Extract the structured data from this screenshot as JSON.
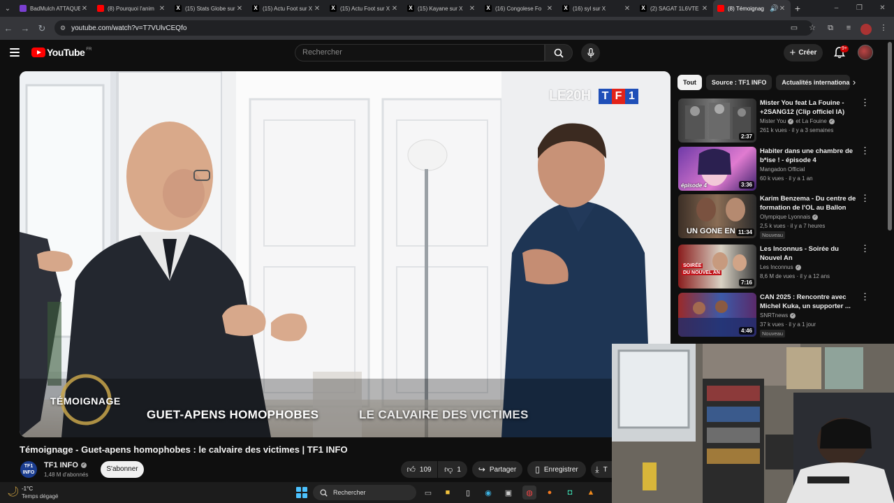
{
  "browser": {
    "tabs": [
      {
        "label": "BadMulch ATTAQUE",
        "favicon_color": "#7a3fd1"
      },
      {
        "label": "(8) Pourquoi l'anim",
        "favicon_color": "#ff0000"
      },
      {
        "label": "(15) Stats Globe sur X",
        "favicon_color": "#000000"
      },
      {
        "label": "(15) Actu Foot sur X",
        "favicon_color": "#000000"
      },
      {
        "label": "(15) Actu Foot sur X",
        "favicon_color": "#000000"
      },
      {
        "label": "(15) Kayane sur X",
        "favicon_color": "#000000"
      },
      {
        "label": "(16) Congolese Fo",
        "favicon_color": "#000000"
      },
      {
        "label": "(16) syl sur X",
        "favicon_color": "#000000"
      },
      {
        "label": "(2) SAGAT 1L6VTE",
        "favicon_color": "#000000"
      },
      {
        "label": "(8) Témoignag",
        "favicon_color": "#ff0000",
        "active": true
      }
    ],
    "new_tab": "+",
    "url": "youtube.com/watch?v=T7VUlvCEQfo",
    "window_controls": [
      "–",
      "❐",
      "✕"
    ]
  },
  "masthead": {
    "logo_text": "YouTube",
    "country": "FR",
    "search_placeholder": "Rechercher",
    "create_label": "Créer",
    "notifications_count": "9+"
  },
  "video": {
    "watermark_20h": "LE20H",
    "watermark_tf1": [
      "T",
      "F",
      "1"
    ],
    "tf1_colors": [
      "#1f4fb8",
      "#e2231a",
      "#1f4fb8"
    ],
    "program_logo": "TÉMOIGNAGE",
    "caption_main": "GUET-APENS HOMOPHOBES",
    "caption_sub": "LE CALVAIRE DES VICTIMES",
    "title": "Témoignage - Guet-apens homophobes : le calvaire des victimes | TF1 INFO"
  },
  "channel": {
    "avatar_text_1": "TF1",
    "avatar_text_2": "INFO",
    "name": "TF1 INFO",
    "subscribers": "1,48 M d'abonnés",
    "subscribe_label": "S'abonner"
  },
  "actions": {
    "likes": "109",
    "dislikes": "1",
    "share": "Partager",
    "save": "Enregistrer",
    "download": "T"
  },
  "chips": [
    "Tout",
    "Source : TF1 INFO",
    "Actualités internationales"
  ],
  "recommendations": [
    {
      "title": "Mister You feat La Fouine - +2SANG12 (Clip officiel IA)",
      "channel": "Mister You",
      "channel_extra": "et La Fouine",
      "meta": "261 k vues · il y a 3 semaines",
      "duration": "2:37",
      "badge": ""
    },
    {
      "title": "Habiter dans une chambre de b*ise ! - épisode 4",
      "channel": "Mangadon Official",
      "channel_extra": "",
      "meta": "60 k vues · il y a 1 an",
      "duration": "3:36",
      "badge": ""
    },
    {
      "title": "Karim Benzema - Du centre de formation de l'OL au Ballon d'...",
      "channel": "Olympique Lyonnais",
      "channel_extra": "",
      "meta": "2,5 k vues · il y a 7 heures",
      "duration": "11:34",
      "badge": "Nouveau"
    },
    {
      "title": "Les Inconnus - Soirée du Nouvel An",
      "channel": "Les Inconnus",
      "channel_extra": "",
      "meta": "8,6 M de vues · il y a 12 ans",
      "duration": "7:16",
      "badge": ""
    },
    {
      "title": "CAN 2025 : Rencontre avec Michel Kuka, un supporter ...",
      "channel": "SNRTnews",
      "channel_extra": "",
      "meta": "37 k vues · il y a 1 jour",
      "duration": "4:46",
      "badge": "Nouveau"
    }
  ],
  "thumb_text": {
    "r3": "UN GONE EN",
    "r4_a": "SOIRÉE",
    "r4_b": "DU NOUVEL AN",
    "r2": "épisode 4"
  },
  "taskbar": {
    "temperature": "-1°C",
    "weather": "Temps dégagé",
    "search": "Rechercher"
  }
}
